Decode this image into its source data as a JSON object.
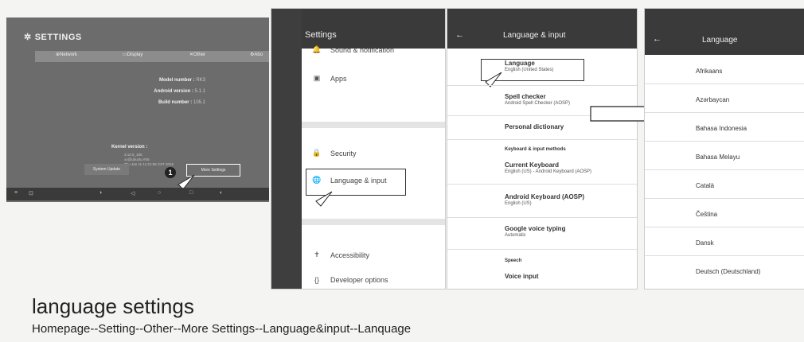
{
  "panel_settings_tv": {
    "title": "SETTINGS",
    "tabs": [
      "Network",
      "Display",
      "Other",
      "Abo"
    ],
    "info": [
      {
        "label": "Model number :",
        "value": "RK3"
      },
      {
        "label": "Android version :",
        "value": "5.1.1"
      },
      {
        "label": "Build number :",
        "value": "105.1"
      }
    ],
    "kernel_label": "Kernel version :",
    "kernel_detail": [
      "3.10.0_105",
      "xx@ubuntu #45",
      "Thu Jan 11 11:21:56 CST 2015"
    ],
    "system_update_button": "System Update",
    "more_settings_button": "More Settings",
    "step_number": "1"
  },
  "panel_settings_list": {
    "title": "Settings",
    "items": [
      {
        "icon": "🔔",
        "label": "Sound & notification"
      },
      {
        "icon": "▣",
        "label": "Apps"
      },
      {
        "icon": "🔒",
        "label": "Security"
      },
      {
        "icon": "🌐",
        "label": "Language & input"
      },
      {
        "icon": "✝",
        "label": "Accessibility"
      },
      {
        "icon": "{}",
        "label": "Developer options"
      }
    ]
  },
  "panel_language_input": {
    "back": "←",
    "title": "Language & input",
    "entries": [
      {
        "title": "Language",
        "sub": "English (United States)"
      },
      {
        "title": "Spell checker",
        "sub": "Android Spell Checker (AOSP)"
      },
      {
        "title": "Personal dictionary",
        "sub": ""
      },
      {
        "title": "Current Keyboard",
        "sub": "English (US) - Android Keyboard (AOSP)"
      },
      {
        "title": "Android Keyboard (AOSP)",
        "sub": "English (US)"
      },
      {
        "title": "Google voice typing",
        "sub": "Automatic"
      },
      {
        "title": "Voice input",
        "sub": ""
      }
    ],
    "category_keyboard": "Keyboard & input methods",
    "category_speech": "Speech"
  },
  "panel_language": {
    "back": "←",
    "title": "Language",
    "languages": [
      "Afrikaans",
      "Azərbaycan",
      "Bahasa Indonesia",
      "Bahasa Melayu",
      "Català",
      "Čeština",
      "Dansk",
      "Deutsch (Deutschland)"
    ]
  },
  "caption": {
    "title": "language settings",
    "path": "Homepage--Setting--Other--More Settings--Language&input--Lanquage"
  }
}
